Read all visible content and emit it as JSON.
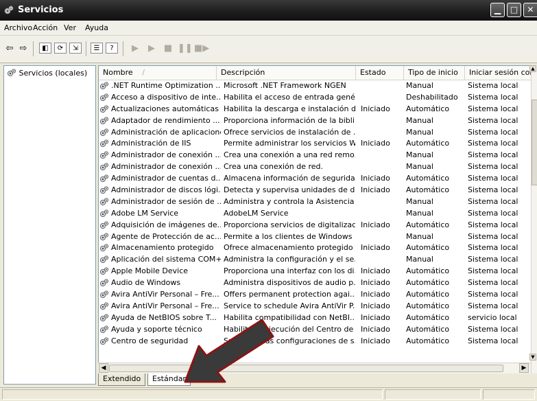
{
  "window": {
    "title": "Servicios"
  },
  "menu": [
    "Archivo",
    "Acción",
    "Ver",
    "Ayuda"
  ],
  "tree": {
    "root_label": "Servicios (locales)"
  },
  "columns": [
    "Nombre",
    "Descripción",
    "Estado",
    "Tipo de inicio",
    "Iniciar sesión com"
  ],
  "sort_indicator": "/",
  "rows": [
    [
      ".NET Runtime Optimization ...",
      "Microsoft .NET Framework NGEN",
      "",
      "Manual",
      "Sistema local"
    ],
    [
      "Acceso a dispositivo de inte...",
      "Habilita el acceso de entrada gené...",
      "",
      "Deshabilitado",
      "Sistema local"
    ],
    [
      "Actualizaciones automáticas",
      "Habilita la descarga e instalación d...",
      "Iniciado",
      "Automático",
      "Sistema local"
    ],
    [
      "Adaptador de rendimiento ...",
      "Proporciona información de la bibli...",
      "",
      "Manual",
      "Sistema local"
    ],
    [
      "Administración de aplicaciones",
      "Ofrece servicios de instalación de ...",
      "",
      "Manual",
      "Sistema local"
    ],
    [
      "Administración de IIS",
      "Permite administrar los servicios W...",
      "Iniciado",
      "Automático",
      "Sistema local"
    ],
    [
      "Administrador de conexión ...",
      "Crea una conexión a una red remo...",
      "",
      "Manual",
      "Sistema local"
    ],
    [
      "Administrador de conexión ...",
      "Crea una conexión de red.",
      "",
      "Manual",
      "Sistema local"
    ],
    [
      "Administrador de cuentas d...",
      "Almacena información de segurida...",
      "Iniciado",
      "Automático",
      "Sistema local"
    ],
    [
      "Administrador de discos lógi...",
      "Detecta y supervisa unidades de d...",
      "Iniciado",
      "Automático",
      "Sistema local"
    ],
    [
      "Administrador de sesión de ...",
      "Administra y controla la Asistencia ...",
      "",
      "Manual",
      "Sistema local"
    ],
    [
      "Adobe LM Service",
      "AdobeLM Service",
      "",
      "Manual",
      "Sistema local"
    ],
    [
      "Adquisición de imágenes de...",
      "Proporciona servicios de digitalizac...",
      "Iniciado",
      "Automático",
      "Sistema local"
    ],
    [
      "Agente de Protección de ac...",
      "Permite a los clientes de Windows ...",
      "",
      "Manual",
      "Sistema local"
    ],
    [
      "Almacenamiento protegido",
      "Ofrece almacenamiento protegido ...",
      "Iniciado",
      "Automático",
      "Sistema local"
    ],
    [
      "Aplicación del sistema COM+",
      "Administra la configuración y el se...",
      "",
      "Manual",
      "Sistema local"
    ],
    [
      "Apple Mobile Device",
      "Proporciona una interfaz con los di...",
      "Iniciado",
      "Automático",
      "Sistema local"
    ],
    [
      "Audio de Windows",
      "Administra dispositivos de audio p...",
      "Iniciado",
      "Automático",
      "Sistema local"
    ],
    [
      "Avira AntiVir Personal – Fre...",
      "Offers permanent protection agai...",
      "Iniciado",
      "Automático",
      "Sistema local"
    ],
    [
      "Avira AntiVir Personal – Fre...",
      "Service to schedule Avira AntiVir P...",
      "Iniciado",
      "Automático",
      "Sistema local"
    ],
    [
      "Ayuda de NetBIOS sobre T...",
      "Habilita compatibilidad con NetBI...",
      "Iniciado",
      "Automático",
      "servicio local"
    ],
    [
      "Ayuda y soporte técnico",
      "Habilita la ejecución del Centro de ...",
      "Iniciado",
      "Automático",
      "Sistema local"
    ],
    [
      "Centro de seguridad",
      "Supervisa las configuraciones de s...",
      "Iniciado",
      "Automático",
      "Sistema local"
    ]
  ],
  "tabs": [
    "Extendido",
    "Estándar"
  ],
  "active_tab": "Estándar",
  "colors": {
    "titlebar": "#1e1e1e",
    "arrow": "#3c3c3c",
    "arrow_outline": "#8a1515",
    "pane_border": "#7f9db9"
  }
}
